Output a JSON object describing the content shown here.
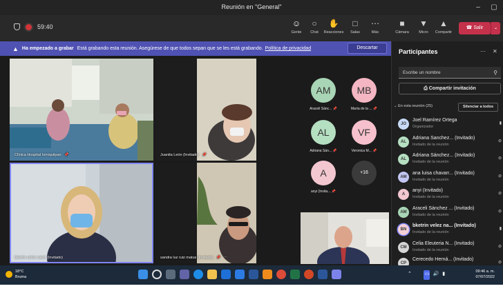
{
  "window": {
    "title": "Reunión en \"General\"",
    "minimize": "–",
    "restore": "▢"
  },
  "meeting": {
    "timer": "59:40",
    "tools": [
      {
        "label": "Gente",
        "icon": "people-icon"
      },
      {
        "label": "Chat",
        "icon": "chat-icon"
      },
      {
        "label": "Reacciones",
        "icon": "reactions-icon"
      },
      {
        "label": "Salas",
        "icon": "rooms-icon"
      },
      {
        "label": "Más",
        "icon": "more-icon"
      },
      {
        "label": "Cámara",
        "icon": "camera-icon"
      },
      {
        "label": "Micro",
        "icon": "mic-icon"
      },
      {
        "label": "Compartir",
        "icon": "share-icon"
      }
    ],
    "leave_label": "Salir"
  },
  "banner": {
    "bold": "Ha empezado a grabar",
    "text": "Está grabando esta reunión. Asegúrese de que todos sepan que se les está grabando.",
    "link": "Política de privacidad",
    "dismiss": "Descartar"
  },
  "tiles": [
    {
      "name": "Clínica Hospital Ixmiquilpan"
    },
    {
      "name": "Juanita León (Invitado)"
    },
    {
      "name": "bketrin velez naizir (Invitado)"
    },
    {
      "name": "sandra luz ruiz matus (Invitado)"
    }
  ],
  "gallery": [
    {
      "initials": "AM",
      "name": "Araceli Sánc...",
      "color": "#a8d5b5"
    },
    {
      "initials": "MB",
      "name": "María de la ...",
      "color": "#f4b6c2"
    },
    {
      "initials": "AL",
      "name": "Adriana Sán...",
      "color": "#b5dfc1"
    },
    {
      "initials": "VF",
      "name": "Veronica M...",
      "color": "#f6c1cc"
    },
    {
      "initials": "A",
      "name": "anyi (Invita...",
      "color": "#f3c7d0"
    },
    {
      "initials": "+16",
      "name": "",
      "color": "#3b3b3b"
    }
  ],
  "panel": {
    "title": "Participantes",
    "search_placeholder": "Escribe un nombre",
    "share_invite": "Compartir invitación",
    "in_meeting": "En esta reunión (25)",
    "mute_all": "Silenciar a todos",
    "participants": [
      {
        "initials": "JO",
        "name": "Joel Ramírez Ortega",
        "role": "Organizador",
        "color": "#c7d9f5"
      },
      {
        "initials": "AL",
        "name": "Adriana Sanchez... (Invitado)",
        "role": "Invitado de la reunión",
        "color": "#b5dfc1"
      },
      {
        "initials": "AL",
        "name": "Adriana Sánchez... (Invitado)",
        "role": "Invitado de la reunión",
        "color": "#b5dfc1"
      },
      {
        "initials": "AM",
        "name": "ana luisa chavarr... (Invitado)",
        "role": "Invitado de la reunión",
        "color": "#c3c6f2"
      },
      {
        "initials": "A",
        "name": "anyi (Invitado)",
        "role": "Invitado de la reunión",
        "color": "#f3c7d0"
      },
      {
        "initials": "AM",
        "name": "Araceli Sánchez ... (Invitado)",
        "role": "Invitado de la reunión",
        "color": "#a8d5b5"
      },
      {
        "initials": "BN",
        "name": "bketrin velez na... (Invitado)",
        "role": "Invitado de la reunión",
        "color": "#f4d0d6"
      },
      {
        "initials": "CM",
        "name": "Celia Eleuteria N... (Invitado)",
        "role": "Invitado de la reunión",
        "color": "#d6d6d6"
      },
      {
        "initials": "CP",
        "name": "Cerecedo Herná... (Invitado)",
        "role": "",
        "color": "#d6d6d6"
      }
    ]
  },
  "taskbar": {
    "weather_temp": "18°C",
    "weather_desc": "Bruma",
    "time": "09:46 a. m.",
    "date": "07/07/2022"
  }
}
